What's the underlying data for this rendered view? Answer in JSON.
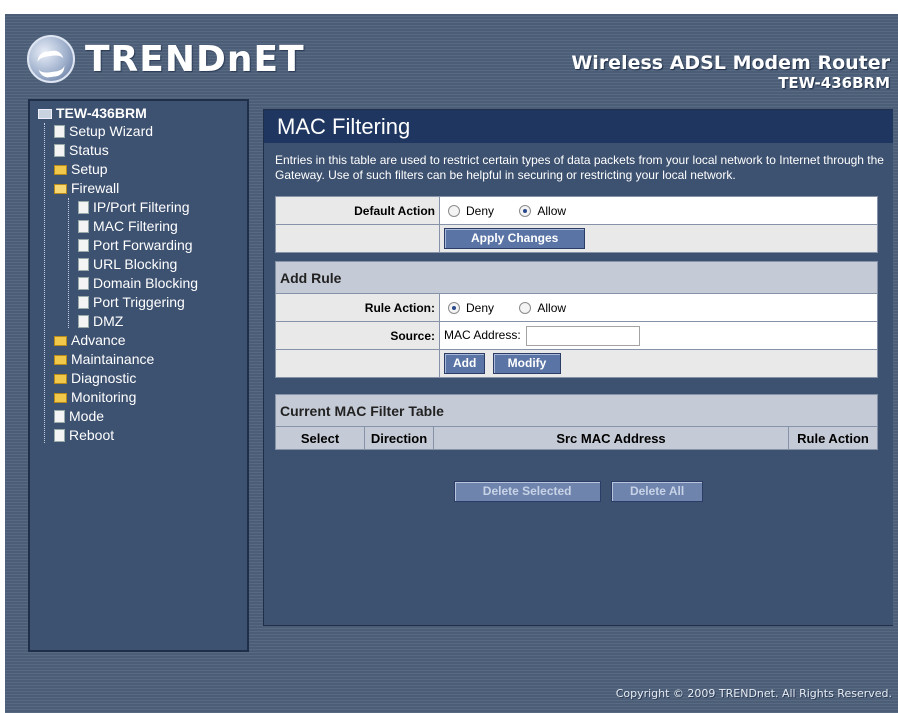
{
  "header": {
    "logo_text": "TRENDnET",
    "product_name": "Wireless ADSL Modem Router",
    "model": "TEW-436BRM"
  },
  "sidebar": {
    "root": "TEW-436BRM",
    "items": [
      {
        "label": "Setup Wizard",
        "icon": "doc-icon"
      },
      {
        "label": "Status",
        "icon": "doc-icon"
      },
      {
        "label": "Setup",
        "icon": "folder-icon"
      },
      {
        "label": "Firewall",
        "icon": "folder-open-icon"
      },
      {
        "label": "IP/Port Filtering",
        "icon": "doc-icon"
      },
      {
        "label": "MAC Filtering",
        "icon": "doc-icon"
      },
      {
        "label": "Port Forwarding",
        "icon": "doc-icon"
      },
      {
        "label": "URL Blocking",
        "icon": "doc-icon"
      },
      {
        "label": "Domain Blocking",
        "icon": "doc-icon"
      },
      {
        "label": "Port Triggering",
        "icon": "doc-icon"
      },
      {
        "label": "DMZ",
        "icon": "doc-icon"
      },
      {
        "label": "Advance",
        "icon": "folder-icon"
      },
      {
        "label": "Maintainance",
        "icon": "folder-icon"
      },
      {
        "label": "Diagnostic",
        "icon": "folder-icon"
      },
      {
        "label": "Monitoring",
        "icon": "folder-icon"
      },
      {
        "label": "Mode",
        "icon": "doc-icon"
      },
      {
        "label": "Reboot",
        "icon": "doc-icon"
      }
    ]
  },
  "main": {
    "title": "MAC Filtering",
    "description": "Entries in this table are used to restrict certain types of data packets from your local network to Internet through the Gateway. Use of such filters can be helpful in securing or restricting your local network.",
    "default_action": {
      "label": "Default Action",
      "options": [
        "Deny",
        "Allow"
      ],
      "selected": "Allow"
    },
    "apply_button": "Apply Changes",
    "add_rule": {
      "section_title": "Add Rule",
      "rule_action_label": "Rule Action:",
      "rule_options": [
        "Deny",
        "Allow"
      ],
      "rule_selected": "Deny",
      "source_label": "Source:",
      "mac_label": "MAC Address:",
      "mac_value": "",
      "add_button": "Add",
      "modify_button": "Modify"
    },
    "table": {
      "section_title": "Current MAC Filter Table",
      "columns": [
        "Select",
        "Direction",
        "Src MAC Address",
        "Rule Action"
      ],
      "rows": []
    },
    "delete_selected_button": "Delete Selected",
    "delete_all_button": "Delete All"
  },
  "footer": {
    "copyright": "Copyright © 2009 TRENDnet. All Rights Reserved."
  }
}
